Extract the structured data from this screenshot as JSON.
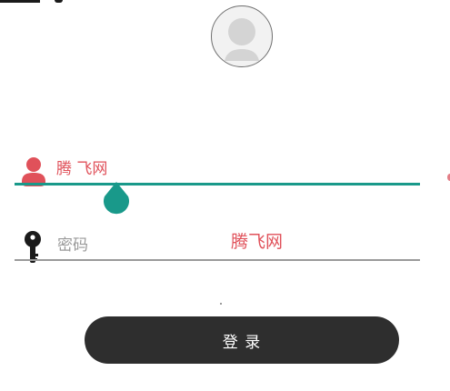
{
  "header": {
    "avatar_icon": "user-avatar-icon"
  },
  "login_form": {
    "username": {
      "icon": "user-icon",
      "value": "腾 飞网",
      "focused": true,
      "accent_color": "#19998a",
      "icon_color": "#e0515a"
    },
    "password": {
      "icon": "key-icon",
      "placeholder": "密码",
      "value": ""
    },
    "brand_text": "腾飞网",
    "login_button_label": "登 录"
  },
  "colors": {
    "accent": "#19998a",
    "brand_red": "#e0515a",
    "button_bg": "#2e2e2e"
  }
}
